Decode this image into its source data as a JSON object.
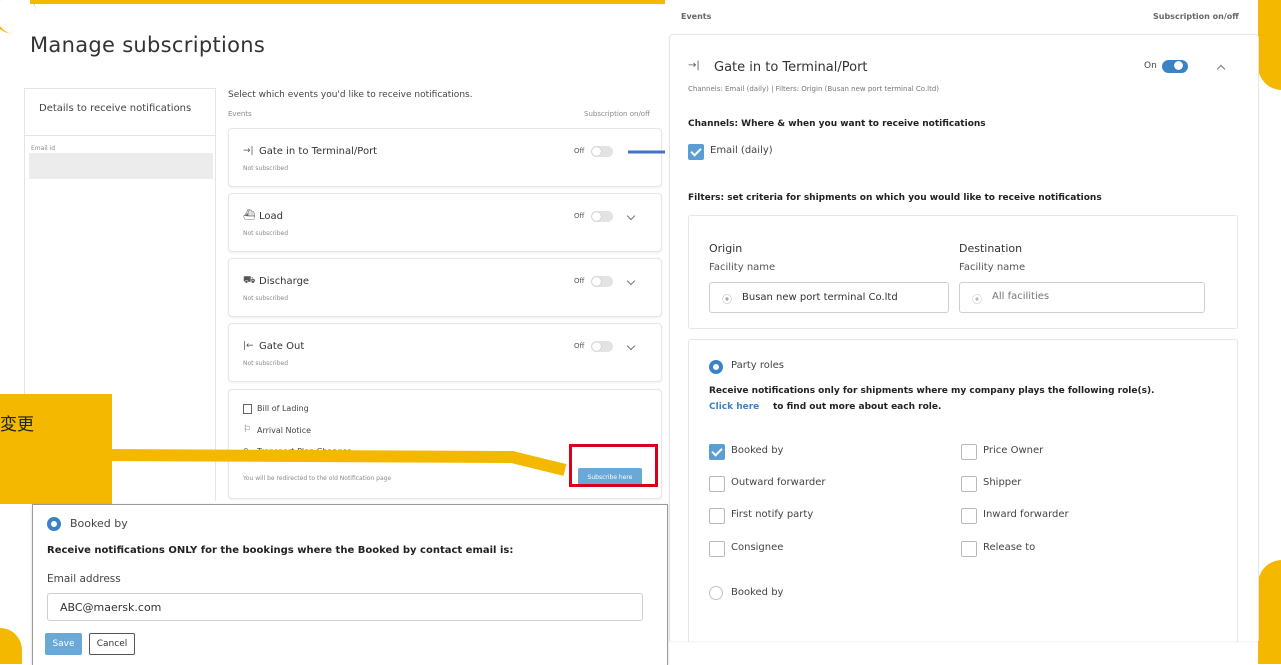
{
  "left_page": {
    "title": "Manage subscriptions",
    "details_panel": {
      "heading": "Details to receive notifications",
      "email_label": "Email id"
    },
    "intro": "Select which events you'd like to receive notifications.",
    "events_header": "Events",
    "subscription_header": "Subscription on/off",
    "events": [
      {
        "icon": "gate-in-icon",
        "glyph": "→|",
        "name": "Gate in to Terminal/Port",
        "status": "Not subscribed",
        "toggle": "Off"
      },
      {
        "icon": "load-icon",
        "glyph": "⛴",
        "name": "Load",
        "status": "Not subscribed",
        "toggle": "Off"
      },
      {
        "icon": "discharge-icon",
        "glyph": "⛟",
        "name": "Discharge",
        "status": "Not subscribed",
        "toggle": "Off"
      },
      {
        "icon": "gate-out-icon",
        "glyph": "|←",
        "name": "Gate Out",
        "status": "Not subscribed",
        "toggle": "Off"
      }
    ],
    "legacy": {
      "items": [
        "Bill of Lading",
        "Arrival Notice",
        "Transport Plan Changes"
      ],
      "note": "You will be redirected to the old Notification page",
      "button": "Subscribe here"
    }
  },
  "callout": {
    "text": "変更"
  },
  "right_page": {
    "events_header": "Events",
    "subscription_header": "Subscription on/off",
    "event_name": "Gate in to Terminal/Port",
    "toggle": "On",
    "summary": "Channels: Email (daily) | Filters: Origin (Busan new port terminal Co.ltd)",
    "channels_heading": "Channels: Where & when you want to receive notifications",
    "email_option": "Email (daily)",
    "filters_heading": "Filters: set criteria for shipments on which you would like to receive notifications",
    "origin": {
      "label": "Origin",
      "sub": "Facility name",
      "value": "Busan new port terminal Co.ltd"
    },
    "destination": {
      "label": "Destination",
      "sub": "Facility name",
      "placeholder": "All facilities"
    },
    "party_roles": {
      "label": "Party roles",
      "desc": "Receive notifications only for shipments where my company plays the following role(s).",
      "link": "Click here",
      "link_suffix": "to find out more about each role.",
      "roles_left": [
        {
          "name": "Booked by",
          "checked": true
        },
        {
          "name": "Outward forwarder",
          "checked": false
        },
        {
          "name": "First notify party",
          "checked": false
        },
        {
          "name": "Consignee",
          "checked": false
        }
      ],
      "roles_right": [
        {
          "name": "Price Owner",
          "checked": false
        },
        {
          "name": "Shipper",
          "checked": false
        },
        {
          "name": "Inward forwarder",
          "checked": false
        },
        {
          "name": "Release to",
          "checked": false
        }
      ],
      "booked_by_radio": "Booked by"
    }
  },
  "booked_popup": {
    "radio_label": "Booked by",
    "heading": "Receive notifications ONLY for the bookings where the Booked by contact email is:",
    "email_label": "Email address",
    "email_value": "ABC@maersk.com",
    "save": "Save",
    "cancel": "Cancel"
  },
  "colors": {
    "accent": "#3b83c4",
    "highlight": "#f5b800",
    "callout_red": "#d9001b",
    "arrow": "#4472c4"
  }
}
